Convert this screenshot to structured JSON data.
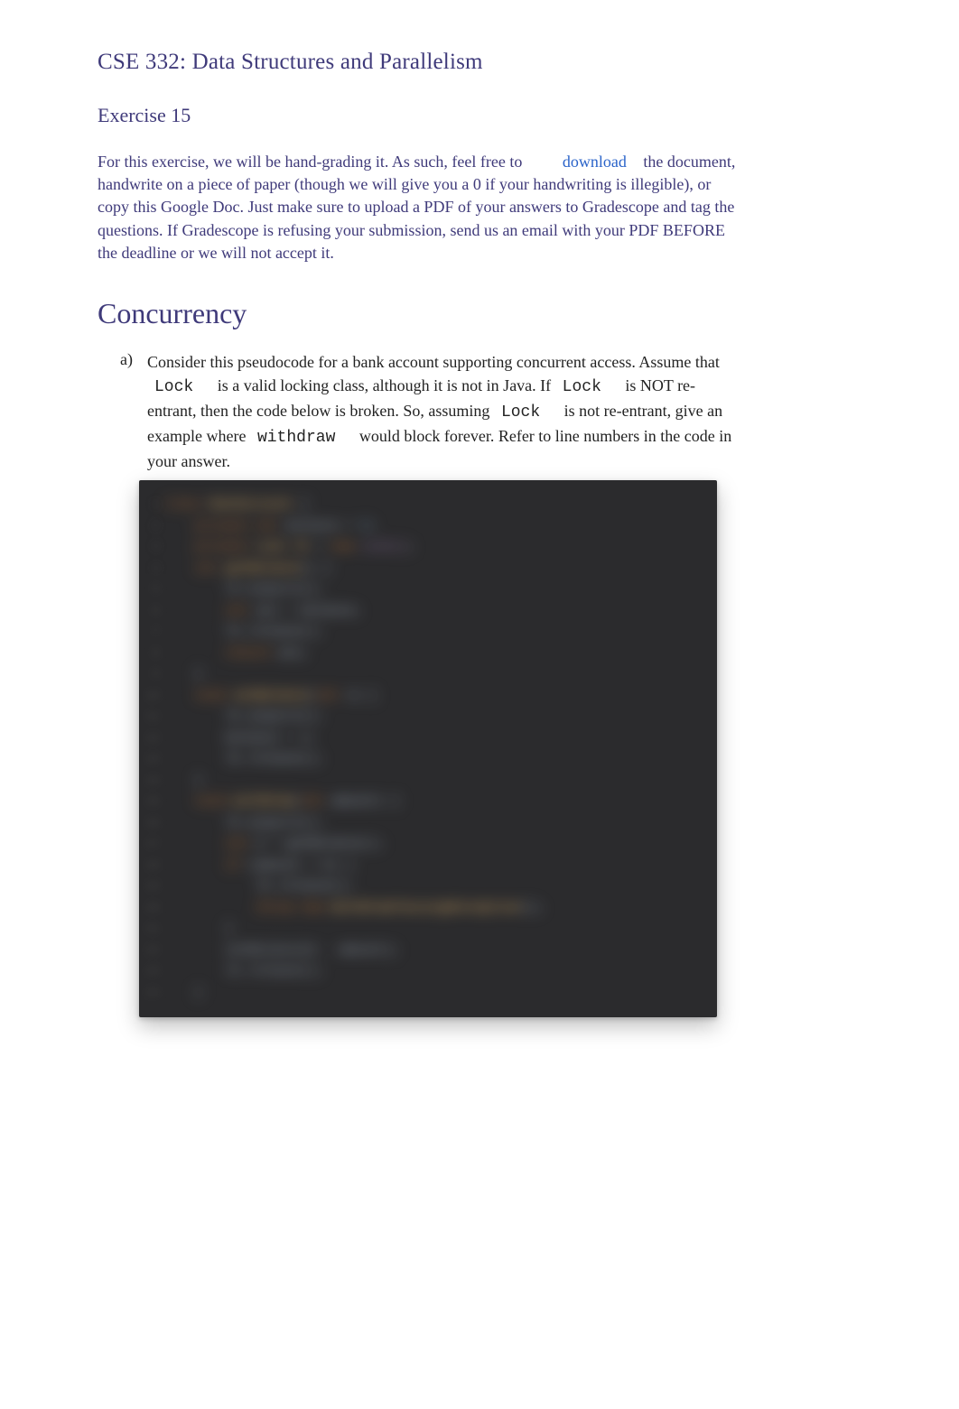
{
  "header": {
    "course_title": "CSE 332: Data Structures and Parallelism",
    "exercise_title": "Exercise 15"
  },
  "intro": {
    "text_before_link": "For this exercise, we will be hand-grading it. As such, feel free to ",
    "download_link_label": "download",
    "text_after_link": " the document, handwrite on a piece of paper (though we will give you a 0 if your handwriting is illegible), or copy this Google Doc. Just make sure to upload a PDF of your answers to Gradescope and tag the questions. If Gradescope is refusing your submission, send us an email with your PDF BEFORE the deadline or we will not accept it."
  },
  "section": {
    "title": "Concurrency",
    "question_marker": "a)",
    "q_parts": {
      "p1": "Consider this pseudocode for a bank account supporting concurrent access. Assume that ",
      "code1": "Lock",
      "p2": " is a valid locking class, although it is not in Java. If ",
      "code2": "Lock",
      "p3": " is NOT re-entrant, then the code below is broken. So, assuming ",
      "code3": "Lock",
      "p4": " is not re-entrant, give an example where ",
      "code4": "withdraw",
      "p5": " would block forever.  Refer to line numbers in the code in your answer."
    }
  },
  "code": {
    "line_count": 24,
    "lines": [
      {
        "indent": 0,
        "tokens": [
          [
            "kw",
            "class"
          ],
          [
            "plain",
            " "
          ],
          [
            "name",
            "BankAccount"
          ],
          [
            "plain",
            " {"
          ]
        ]
      },
      {
        "indent": 2,
        "tokens": [
          [
            "kw",
            "private"
          ],
          [
            "plain",
            " "
          ],
          [
            "type",
            "int"
          ],
          [
            "plain",
            " "
          ],
          [
            "plain",
            "balance = "
          ],
          [
            "lit",
            "0"
          ],
          [
            "plain",
            ";"
          ]
        ]
      },
      {
        "indent": 2,
        "tokens": [
          [
            "kw",
            "private"
          ],
          [
            "plain",
            " "
          ],
          [
            "name",
            "Lock lk"
          ],
          [
            "plain",
            " = "
          ],
          [
            "kw",
            "new"
          ],
          [
            "plain",
            " "
          ],
          [
            "ctor",
            "Lock()"
          ],
          [
            "plain",
            ";"
          ]
        ]
      },
      {
        "indent": 2,
        "tokens": [
          [
            "type",
            "int"
          ],
          [
            "plain",
            " "
          ],
          [
            "name",
            "getBalance"
          ],
          [
            "plain",
            "() {"
          ]
        ]
      },
      {
        "indent": 4,
        "tokens": [
          [
            "plain",
            "lk.acquire();"
          ]
        ]
      },
      {
        "indent": 4,
        "tokens": [
          [
            "type",
            "int"
          ],
          [
            "plain",
            " ans = balance;"
          ]
        ]
      },
      {
        "indent": 4,
        "tokens": [
          [
            "plain",
            "lk.release();"
          ]
        ]
      },
      {
        "indent": 4,
        "tokens": [
          [
            "kw",
            "return"
          ],
          [
            "plain",
            " ans;"
          ]
        ]
      },
      {
        "indent": 2,
        "tokens": [
          [
            "plain",
            "}"
          ]
        ]
      },
      {
        "indent": 2,
        "tokens": [
          [
            "type",
            "void"
          ],
          [
            "plain",
            " "
          ],
          [
            "name",
            "setBalance"
          ],
          [
            "plain",
            "("
          ],
          [
            "type",
            "int"
          ],
          [
            "plain",
            " x) {"
          ]
        ]
      },
      {
        "indent": 4,
        "tokens": [
          [
            "plain",
            "lk.acquire();"
          ]
        ]
      },
      {
        "indent": 4,
        "tokens": [
          [
            "plain",
            "balance = x;"
          ]
        ]
      },
      {
        "indent": 4,
        "tokens": [
          [
            "plain",
            "lk.release();"
          ]
        ]
      },
      {
        "indent": 2,
        "tokens": [
          [
            "plain",
            "}"
          ]
        ]
      },
      {
        "indent": 2,
        "tokens": [
          [
            "type",
            "void"
          ],
          [
            "plain",
            " "
          ],
          [
            "name",
            "withdraw"
          ],
          [
            "plain",
            "("
          ],
          [
            "type",
            "int"
          ],
          [
            "plain",
            " amount) {"
          ]
        ]
      },
      {
        "indent": 4,
        "tokens": [
          [
            "plain",
            "lk.acquire();"
          ]
        ]
      },
      {
        "indent": 4,
        "tokens": [
          [
            "type",
            "int"
          ],
          [
            "plain",
            " b = getBalance();"
          ]
        ]
      },
      {
        "indent": 4,
        "tokens": [
          [
            "kw",
            "if"
          ],
          [
            "plain",
            " (amount > b) {"
          ]
        ]
      },
      {
        "indent": 6,
        "tokens": [
          [
            "plain",
            "lk.release();"
          ]
        ]
      },
      {
        "indent": 6,
        "tokens": [
          [
            "kw",
            "throw"
          ],
          [
            "plain",
            " "
          ],
          [
            "kw",
            "new"
          ],
          [
            "plain",
            " "
          ],
          [
            "name",
            "WithdrawTooLargeException"
          ],
          [
            "plain",
            "();"
          ]
        ]
      },
      {
        "indent": 4,
        "tokens": [
          [
            "plain",
            "}"
          ]
        ]
      },
      {
        "indent": 4,
        "tokens": [
          [
            "plain",
            "setBalance(b - amount);"
          ]
        ]
      },
      {
        "indent": 4,
        "tokens": [
          [
            "plain",
            "lk.release();"
          ]
        ]
      },
      {
        "indent": 2,
        "tokens": [
          [
            "plain",
            "}"
          ]
        ]
      }
    ]
  }
}
